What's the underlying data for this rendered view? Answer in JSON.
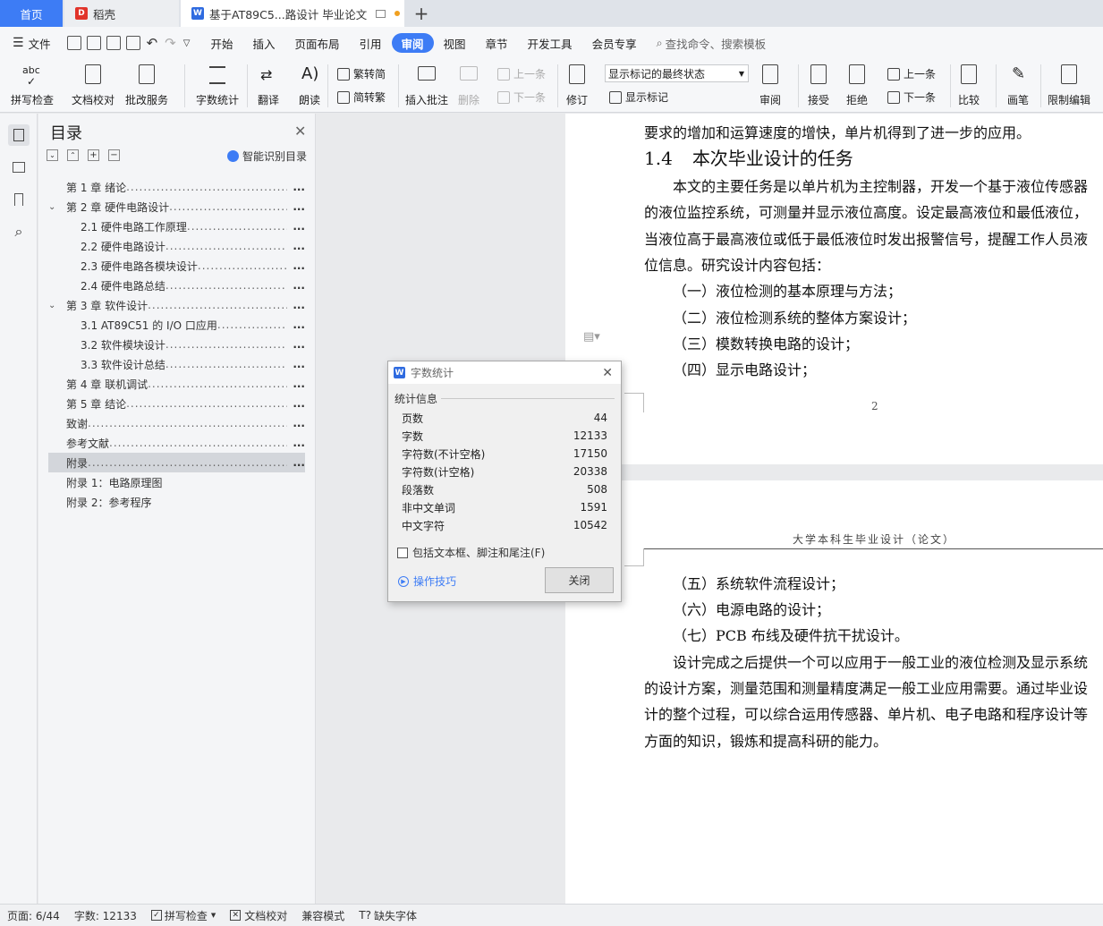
{
  "tabs": {
    "home": "首页",
    "daoke": "稻壳",
    "doc": "基于AT89C5...路设计 毕业论文",
    "plus": "+"
  },
  "menu": {
    "file": "文件",
    "items": [
      "开始",
      "插入",
      "页面布局",
      "引用",
      "审阅",
      "视图",
      "章节",
      "开发工具",
      "会员专享"
    ],
    "search": "查找命令、搜索模板"
  },
  "ribbon": {
    "spell": "拼写检查",
    "proof": "文档校对",
    "correct": "批改服务",
    "wordcount": "字数统计",
    "translate": "翻译",
    "read": "朗读",
    "trad": "繁转简",
    "simp": "简转繁",
    "insert_comment": "插入批注",
    "delete": "删除",
    "prev": "上一条",
    "next": "下一条",
    "track": "修订",
    "markup_state": "显示标记的最终状态",
    "show_markup": "显示标记",
    "review": "审阅",
    "accept": "接受",
    "reject": "拒绝",
    "prev2": "上一条",
    "next2": "下一条",
    "compare": "比较",
    "pen": "画笔",
    "restrict": "限制编辑"
  },
  "nav": {
    "title": "目录",
    "smart": "智能识别目录",
    "toc": [
      {
        "label": "第 1 章  绪论",
        "page": "..."
      },
      {
        "label": "第 2 章  硬件电路设计",
        "page": "..."
      },
      {
        "label": "2.1  硬件电路工作原理",
        "page": "..."
      },
      {
        "label": "2.2  硬件电路设计",
        "page": "..."
      },
      {
        "label": "2.3  硬件电路各模块设计",
        "page": "..."
      },
      {
        "label": "2.4  硬件电路总结",
        "page": "..."
      },
      {
        "label": "第 3 章  软件设计",
        "page": "..."
      },
      {
        "label": "3.1  AT89C51 的 I/O 口应用",
        "page": "..."
      },
      {
        "label": "3.2  软件模块设计",
        "page": "..."
      },
      {
        "label": "3.3  软件设计总结",
        "page": "..."
      },
      {
        "label": "第 4 章  联机调试",
        "page": "..."
      },
      {
        "label": "第 5 章  结论",
        "page": "..."
      },
      {
        "label": "致谢",
        "page": "..."
      },
      {
        "label": "参考文献",
        "page": "..."
      },
      {
        "label": "附录",
        "page": "..."
      },
      {
        "label": "附录 1：电路原理图",
        "page": ""
      },
      {
        "label": "附录 2：参考程序",
        "page": ""
      }
    ]
  },
  "doc": {
    "p1_line0": "要求的增加和运算速度的增快，单片机得到了进一步的应用。",
    "heading_num": "1.4",
    "heading_text": "本次毕业设计的任务",
    "p1_l1": "本文的主要任务是以单片机为主控制器，开发一个基于液位传感器",
    "p1_l2": "的液位监控系统，可测量并显示液位高度。设定最高液位和最低液位，",
    "p1_l3": "当液位高于最高液位或低于最低液位时发出报警信号，提醒工作人员液",
    "p1_l4": "位信息。研究设计内容包括：",
    "item1": "（一）液位检测的基本原理与方法；",
    "item2": "（二）液位检测系统的整体方案设计；",
    "item3": "（三）模数转换电路的设计；",
    "item4": "（四）显示电路设计；",
    "page_num": "2",
    "header2": "大学本科生毕业设计（论文）",
    "item5": "（五）系统软件流程设计；",
    "item6": "（六）电源电路的设计；",
    "item7": "（七）PCB 布线及硬件抗干扰设计。",
    "p2_l1": "设计完成之后提供一个可以应用于一般工业的液位检测及显示系统",
    "p2_l2": "的设计方案，测量范围和测量精度满足一般工业应用需要。通过毕业设",
    "p2_l3": "计的整个过程，可以综合运用传感器、单片机、电子电路和程序设计等",
    "p2_l4": "方面的知识，锻炼和提高科研的能力。"
  },
  "dialog": {
    "title": "字数统计",
    "group": "统计信息",
    "stats": [
      {
        "label": "页数",
        "value": "44"
      },
      {
        "label": "字数",
        "value": "12133"
      },
      {
        "label": "字符数(不计空格)",
        "value": "17150"
      },
      {
        "label": "字符数(计空格)",
        "value": "20338"
      },
      {
        "label": "段落数",
        "value": "508"
      },
      {
        "label": "非中文单词",
        "value": "1591"
      },
      {
        "label": "中文字符",
        "value": "10542"
      }
    ],
    "checkbox": "包括文本框、脚注和尾注(F)",
    "tips": "操作技巧",
    "close": "关闭"
  },
  "status": {
    "page": "页面: 6/44",
    "words": "字数: 12133",
    "spell": "拼写检查",
    "proof": "文档校对",
    "compat": "兼容模式",
    "missing_font": "缺失字体"
  },
  "colors": {
    "accent": "#3d7cf5",
    "tab_bar": "#dfe3e9",
    "ribbon": "#f6f7f9"
  }
}
